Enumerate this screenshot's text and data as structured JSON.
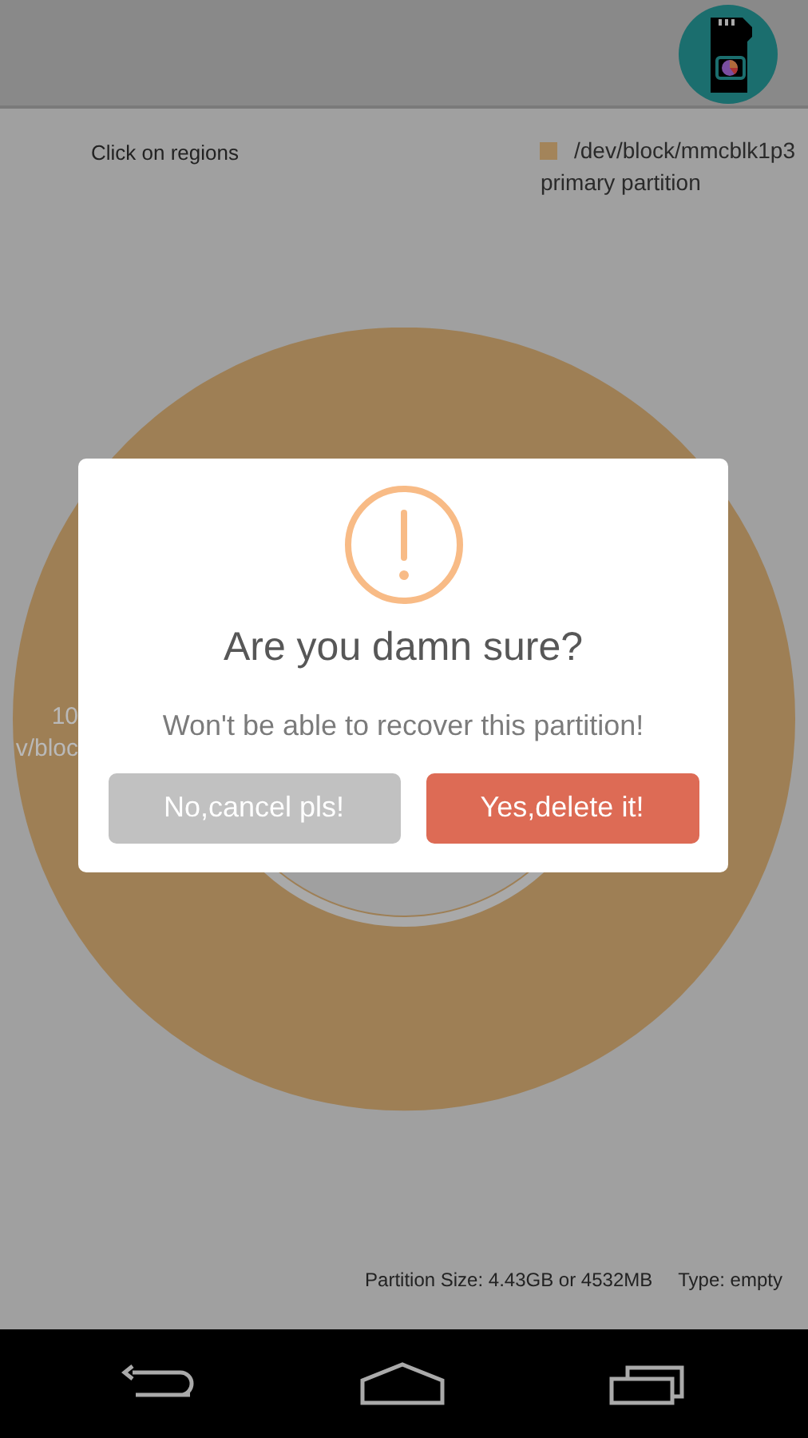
{
  "legend_hint": "Click on regions",
  "legend": [
    {
      "label": "/dev/block/mmcblk1p3",
      "sublabel": "primary partition",
      "color": "#a3845a"
    }
  ],
  "slice_labels": [
    "10",
    "v/bloc"
  ],
  "dialog": {
    "title": "Are you damn sure?",
    "message": "Won't be able to recover this partition!",
    "buttons": [
      {
        "label": "No,cancel pls!",
        "kind": "cancel"
      },
      {
        "label": "Yes,delete it!",
        "kind": "confirm"
      }
    ]
  },
  "status": {
    "size": "Partition Size: 4.43GB or 4532MB",
    "type": "Type: empty"
  }
}
